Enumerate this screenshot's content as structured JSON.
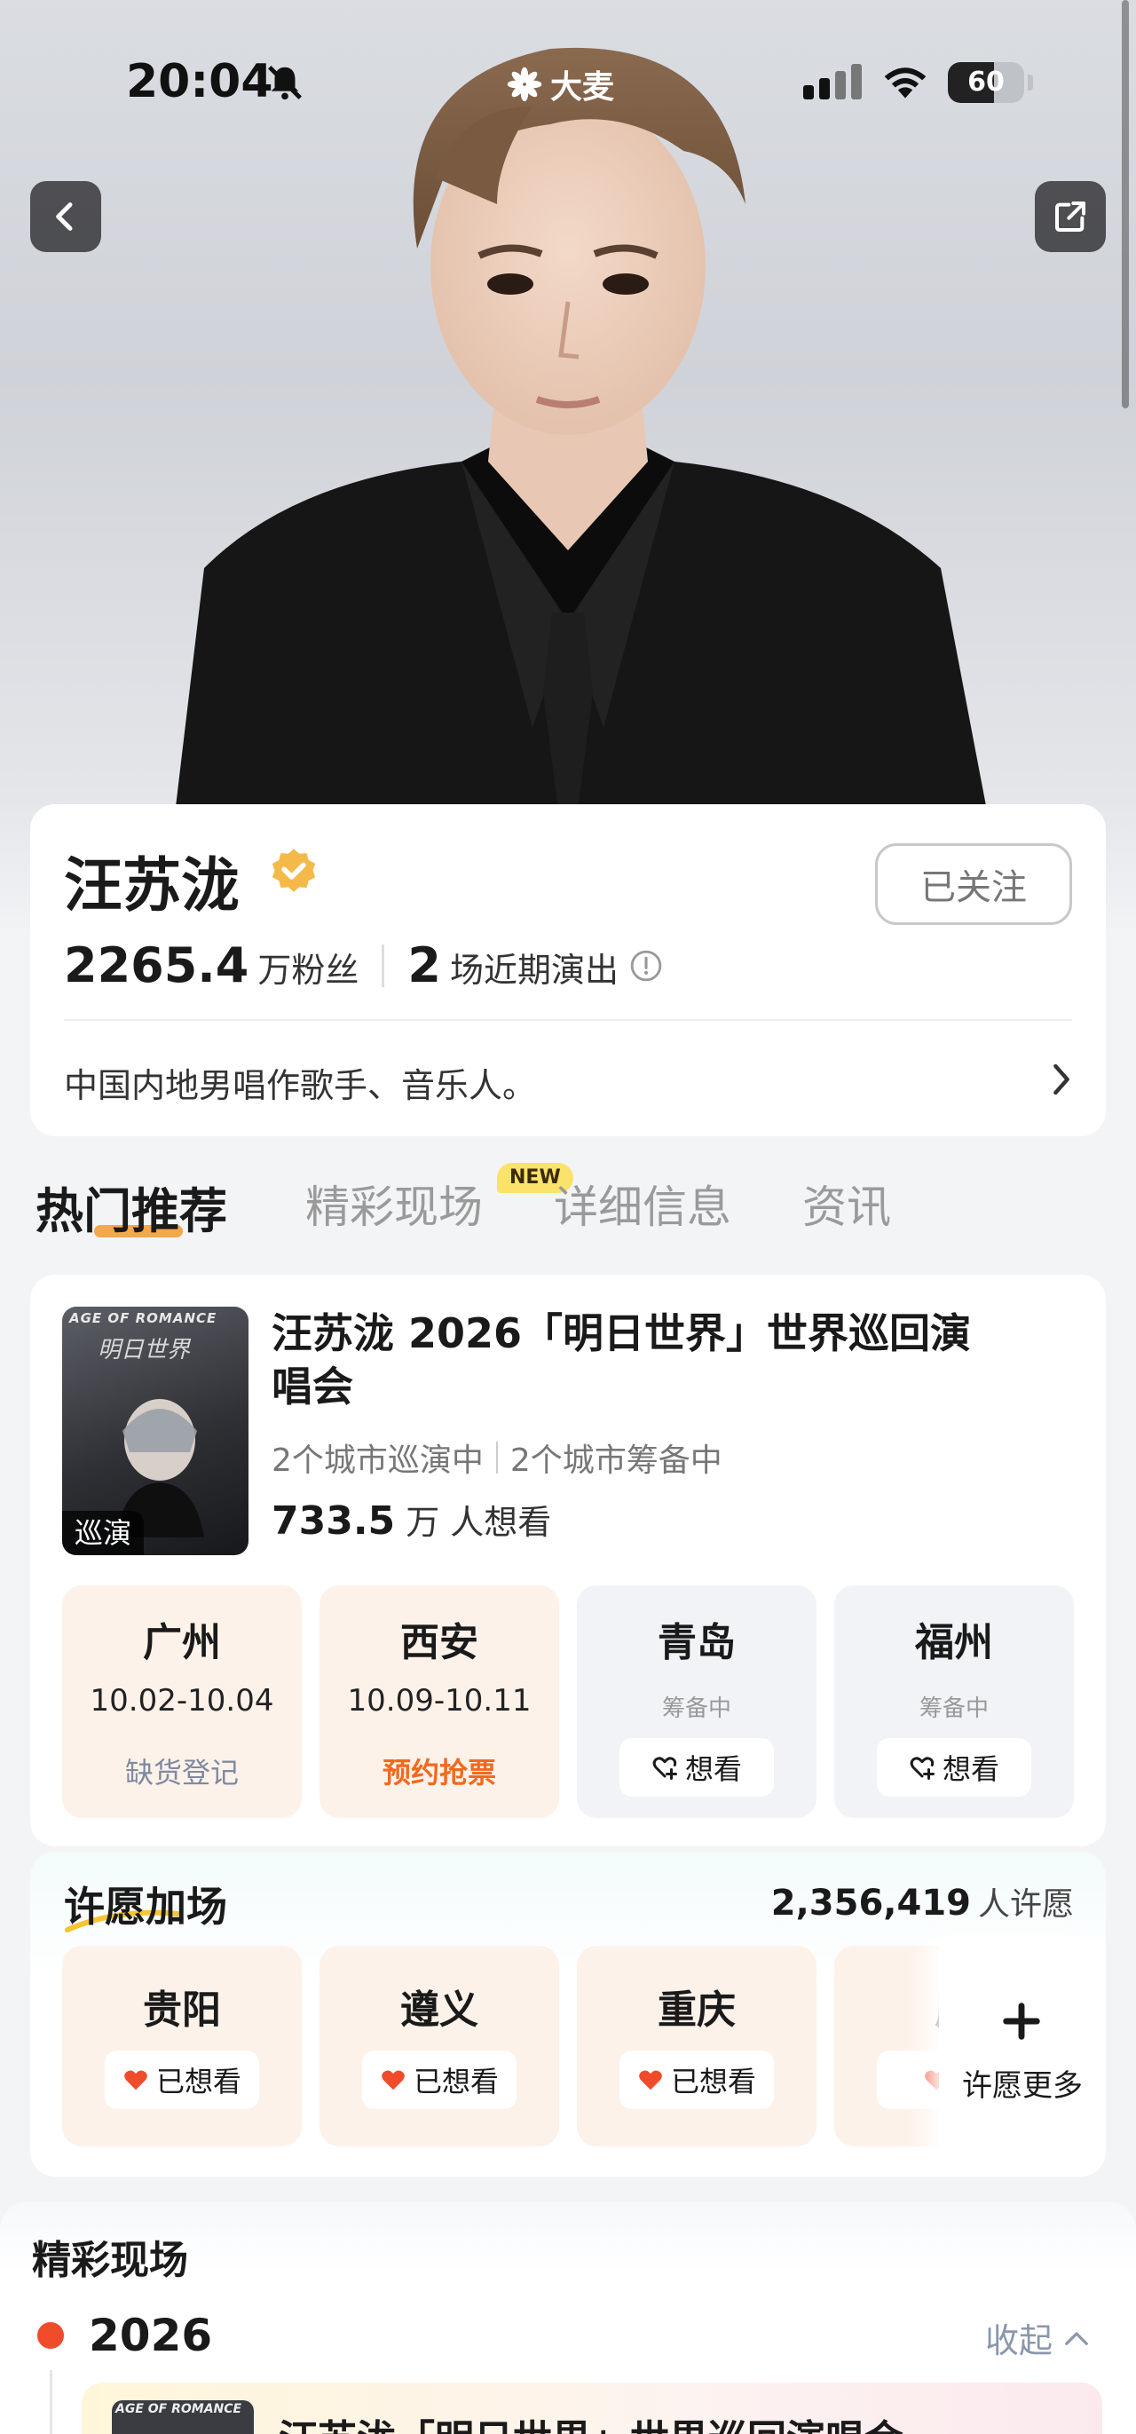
{
  "status_bar": {
    "time": "20:04",
    "logo_text": "大麦",
    "battery": "60",
    "battery_level": 0.6,
    "icons": [
      "bell-muted-icon",
      "signal-icon",
      "wifi-icon",
      "battery-icon"
    ]
  },
  "nav": {
    "back_icon": "chevron-left-icon",
    "share_icon": "share-icon"
  },
  "profile": {
    "name": "汪苏泷",
    "verified_icon": "verified-badge-icon",
    "follow_label": "已关注",
    "fans_count": "2265.4",
    "fans_unit": "万粉丝",
    "shows_count": "2",
    "shows_unit": "场近期演出",
    "bio": "中国内地男唱作歌手、音乐人。"
  },
  "tabs": [
    {
      "label": "热门推荐",
      "active": true
    },
    {
      "label": "精彩现场",
      "badge": "NEW"
    },
    {
      "label": "详细信息"
    },
    {
      "label": "资讯"
    }
  ],
  "tour": {
    "poster_eng": "AGE OF ROMANCE",
    "poster_cn": "明日世界",
    "poster_tag": "巡演",
    "title": "汪苏泷 2026「明日世界」世界巡回演唱会",
    "sub_a": "2个城市巡演中",
    "sub_b": "2个城市筹备中",
    "want_count": "733.5",
    "want_unit": "万 人想看",
    "cities": [
      {
        "name": "广州",
        "date": "10.02-10.04",
        "action": "缺货登记"
      },
      {
        "name": "西安",
        "date": "10.09-10.11",
        "action": "预约抢票"
      },
      {
        "name": "青岛",
        "status": "筹备中",
        "action": "想看"
      },
      {
        "name": "福州",
        "status": "筹备中",
        "action": "想看"
      }
    ]
  },
  "wish": {
    "title": "许愿加场",
    "count": "2,356,419",
    "unit": "人许愿",
    "cities": [
      {
        "name": "贵阳",
        "action": "已想看"
      },
      {
        "name": "遵义",
        "action": "已想看"
      },
      {
        "name": "重庆",
        "action": "已想看"
      },
      {
        "name": "成",
        "action": "已"
      }
    ],
    "more_label": "许愿更多"
  },
  "live": {
    "title": "精彩现场",
    "year": "2026",
    "collapse_label": "收起",
    "item_thumb_text": "AGE OF ROMANCE",
    "item_title": "汪苏泷「明日世界」世界巡回演唱会"
  },
  "colors": {
    "accent_orange": "#f06a1e",
    "tab_underline": "#f29a2b",
    "new_badge": "#fbe26a",
    "heart_red": "#f04b2a",
    "verified_gold": "#f5b94a"
  }
}
